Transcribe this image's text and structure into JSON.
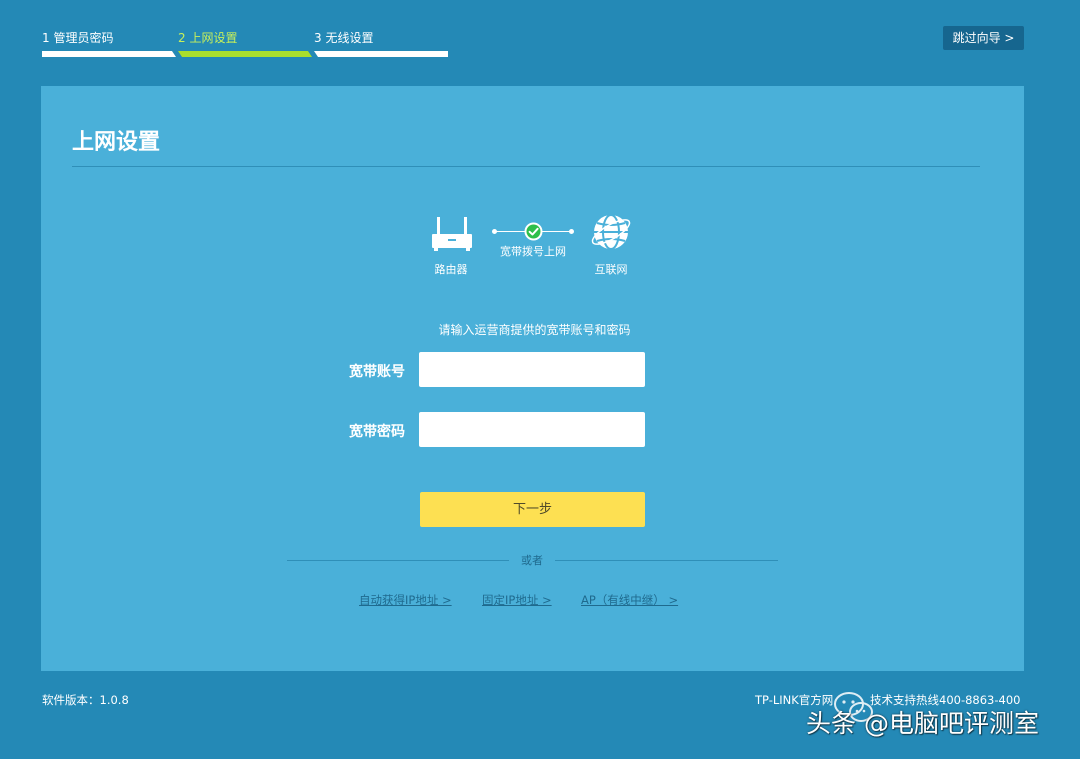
{
  "steps": [
    {
      "label": "1 管理员密码",
      "active": false
    },
    {
      "label": "2 上网设置",
      "active": true
    },
    {
      "label": "3 无线设置",
      "active": false
    }
  ],
  "skip_button": "跳过向导 >",
  "panel": {
    "title": "上网设置",
    "topology": {
      "router_label": "路由器",
      "link_label": "宽带拨号上网",
      "internet_label": "互联网"
    },
    "instruction": "请输入运营商提供的宽带账号和密码",
    "account": {
      "label": "宽带账号",
      "value": "",
      "placeholder": ""
    },
    "password": {
      "label": "宽带密码",
      "value": "",
      "placeholder": ""
    },
    "next_button": "下一步",
    "or_text": "或者",
    "alt_links": [
      "自动获得IP地址 >",
      "固定IP地址 >",
      "AP（有线中继） >"
    ]
  },
  "footer": {
    "version": "软件版本：1.0.8",
    "official_site": "TP-LINK官方网",
    "hotline": "技术支持热线400-8863-400"
  },
  "watermark": "头条 @电脑吧评测室",
  "colors": {
    "background": "#2489b6",
    "panel": "#4ab0d9",
    "active_step": "#a9df2e",
    "next_button": "#fde052",
    "skip_button": "#16668f",
    "check": "#2fbf4a"
  }
}
